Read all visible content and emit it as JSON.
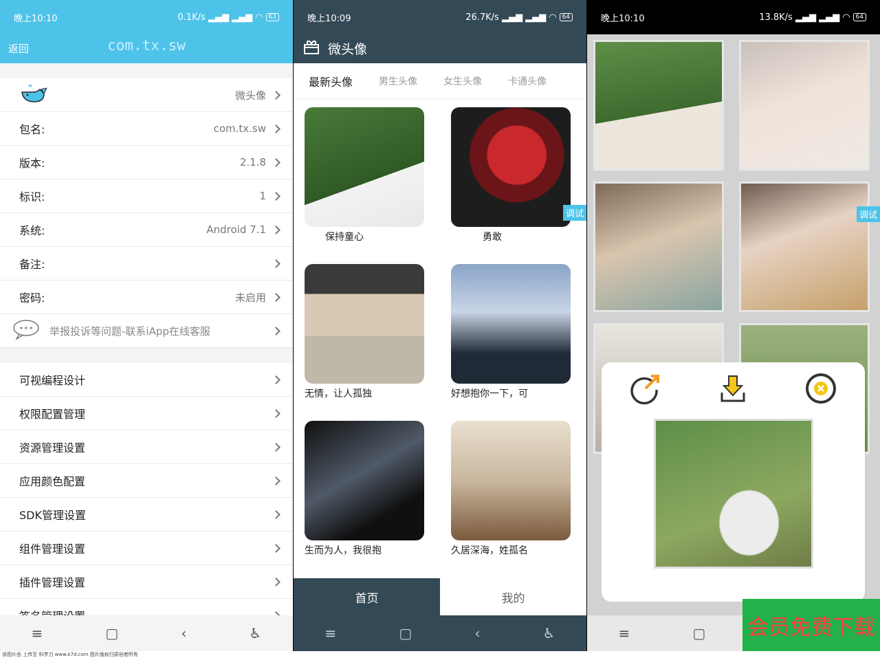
{
  "panel1": {
    "status": {
      "time": "晚上10:10",
      "speed": "0.1K/s",
      "battery": "63"
    },
    "header": {
      "back": "返回",
      "title": "com.tx.sw"
    },
    "info_rows": [
      {
        "label": "",
        "value": "微头像"
      },
      {
        "label": "包名:",
        "value": "com.tx.sw"
      },
      {
        "label": "版本:",
        "value": "2.1.8"
      },
      {
        "label": "标识:",
        "value": "1"
      },
      {
        "label": "系统:",
        "value": "Android 7.1"
      },
      {
        "label": "备注:",
        "value": ""
      },
      {
        "label": "密码:",
        "value": "未启用"
      }
    ],
    "support": "举报投诉等问题-联系iApp在线客服",
    "settings": [
      "可视编程设计",
      "权限配置管理",
      "资源管理设置",
      "应用颜色配置",
      "SDK管理设置",
      "组件管理设置",
      "插件管理设置",
      "签名管理设置"
    ]
  },
  "panel2": {
    "status": {
      "time": "晚上10:09",
      "speed": "26.7K/s",
      "battery": "64"
    },
    "title": "微头像",
    "tabs": [
      "最新头像",
      "男生头像",
      "女生头像",
      "卡通头像"
    ],
    "cards": [
      "保持童心",
      "勇敢",
      "无情，让人孤独",
      "好想抱你一下，可",
      "生而为人，我很抱",
      "久居深海，姓孤名"
    ],
    "debug": "调试",
    "bottom_tabs": [
      "首页",
      "我的"
    ]
  },
  "panel3": {
    "status": {
      "time": "晚上10:10",
      "speed": "13.8K/s",
      "battery": "64"
    },
    "debug": "调试"
  },
  "promo": "会员免费下载",
  "footer_text": "该图片由 上传至 科学刀 www.k7d.com 图片版权归原创者所有",
  "colors": {
    "cyan": "#4ec3e9",
    "slate": "#334955",
    "green": "#22b14c",
    "red": "#ff3d3d"
  }
}
